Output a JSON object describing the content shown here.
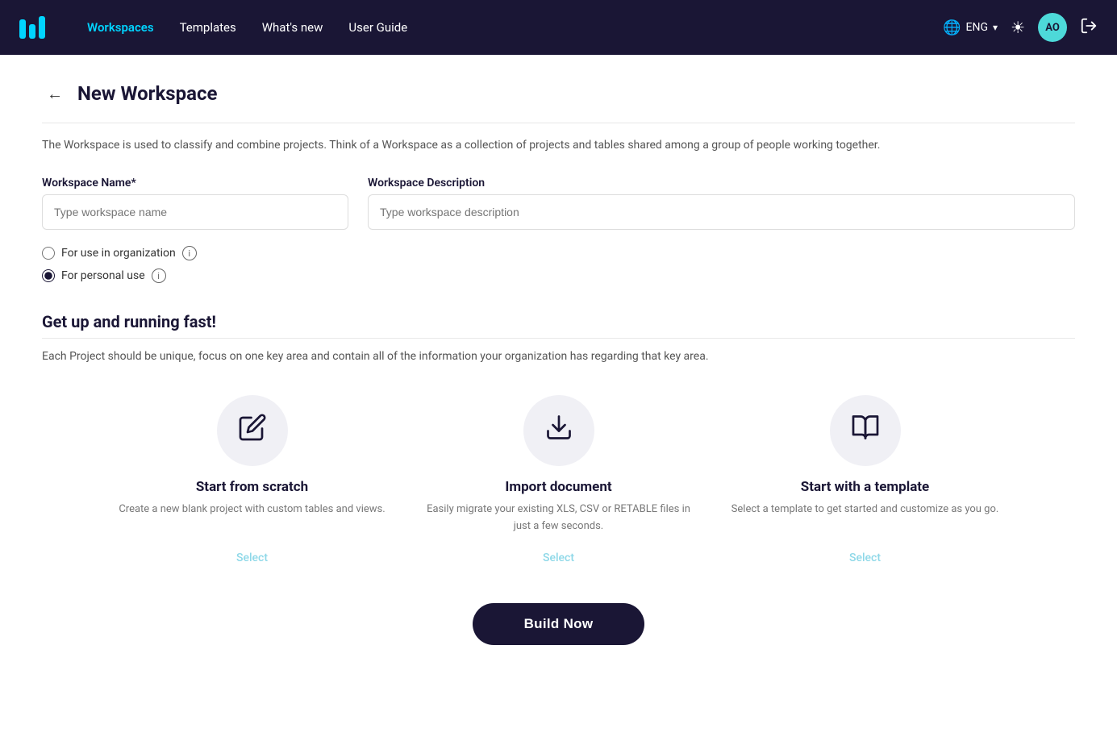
{
  "navbar": {
    "logo_alt": "Retable logo",
    "links": [
      {
        "label": "Workspaces",
        "active": true
      },
      {
        "label": "Templates",
        "active": false
      },
      {
        "label": "What's new",
        "active": false
      },
      {
        "label": "User Guide",
        "active": false
      }
    ],
    "lang": "ENG",
    "avatar_initials": "AO"
  },
  "page": {
    "back_label": "←",
    "title": "New Workspace",
    "description": "The Workspace is used to classify and combine projects. Think of a Workspace as a collection of projects and tables shared among a group of people working together."
  },
  "form": {
    "name_label": "Workspace Name*",
    "name_placeholder": "Type workspace name",
    "desc_label": "Workspace Description",
    "desc_placeholder": "Type workspace description",
    "radio_org_label": "For use in organization",
    "radio_personal_label": "For personal use"
  },
  "section": {
    "title": "Get up and running fast!",
    "description": "Each Project should be unique, focus on one key area and contain all of the information your organization has regarding that key area.",
    "cards": [
      {
        "id": "scratch",
        "title": "Start from scratch",
        "desc": "Create a new blank project with custom tables and views.",
        "select_label": "Select"
      },
      {
        "id": "import",
        "title": "Import document",
        "desc": "Easily migrate your existing XLS, CSV or RETABLE files in just a few seconds.",
        "select_label": "Select"
      },
      {
        "id": "template",
        "title": "Start with a template",
        "desc": "Select a template to get started and customize as you go.",
        "select_label": "Select"
      }
    ]
  },
  "build_btn_label": "Build Now"
}
